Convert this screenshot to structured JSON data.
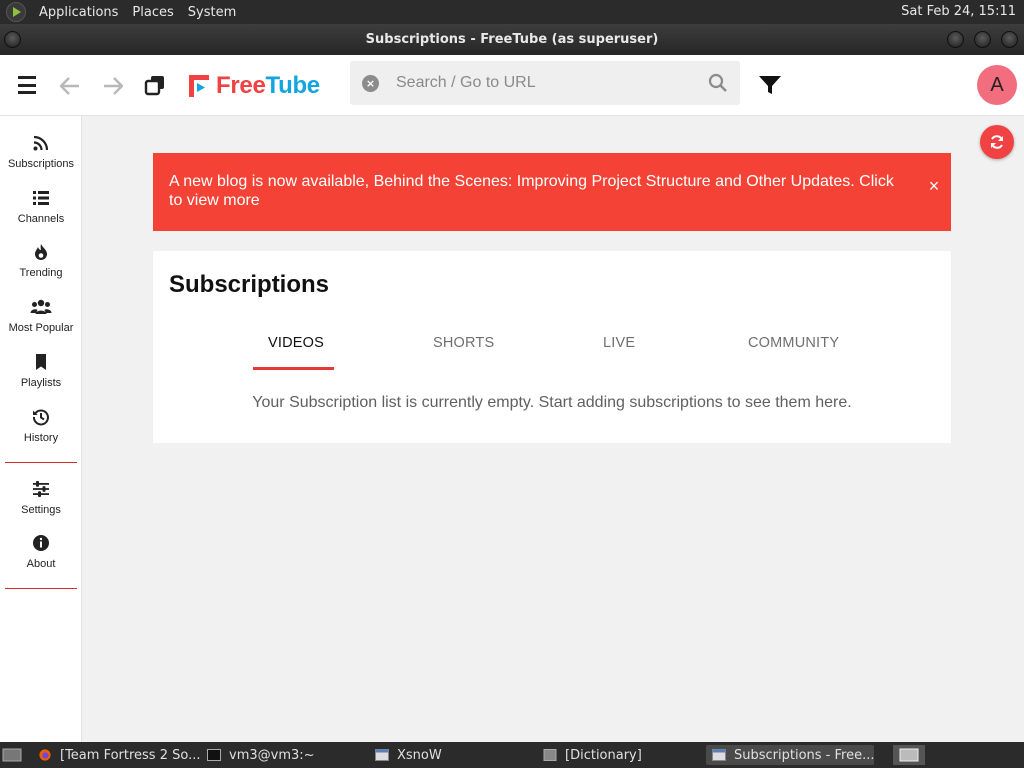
{
  "system_panel": {
    "menus": [
      "Applications",
      "Places",
      "System"
    ],
    "clock": "Sat Feb 24, 15:11"
  },
  "window": {
    "title": "Subscriptions - FreeTube (as superuser)"
  },
  "topnav": {
    "logo_free": "Free",
    "logo_tube": "Tube",
    "search_placeholder": "Search / Go to URL",
    "avatar_letter": "A"
  },
  "sidebar": {
    "items": [
      {
        "label": "Subscriptions",
        "icon": "rss-icon"
      },
      {
        "label": "Channels",
        "icon": "list-icon"
      },
      {
        "label": "Trending",
        "icon": "fire-icon"
      },
      {
        "label": "Most Popular",
        "icon": "users-icon"
      },
      {
        "label": "Playlists",
        "icon": "bookmark-icon"
      },
      {
        "label": "History",
        "icon": "history-icon"
      },
      {
        "label": "Settings",
        "icon": "sliders-icon"
      },
      {
        "label": "About",
        "icon": "info-icon"
      }
    ]
  },
  "banner": {
    "text": "A new blog is now available, Behind the Scenes: Improving Project Structure and Other Updates. Click to view more",
    "close": "×"
  },
  "main": {
    "title": "Subscriptions",
    "tabs": [
      {
        "label": "VIDEOS",
        "active": true
      },
      {
        "label": "SHORTS",
        "active": false
      },
      {
        "label": "LIVE",
        "active": false
      },
      {
        "label": "COMMUNITY",
        "active": false
      }
    ],
    "empty_message": "Your Subscription list is currently empty. Start adding subscriptions to see them here."
  },
  "taskbar": {
    "items": [
      {
        "label": "[Team Fortress 2 So..."
      },
      {
        "label": "vm3@vm3:~"
      },
      {
        "label": "XsnoW"
      },
      {
        "label": "[Dictionary]"
      },
      {
        "label": "Subscriptions - Free..."
      }
    ]
  },
  "colors": {
    "accent": "#f04242",
    "banner": "#f44336",
    "logo_blue": "#14a4df",
    "avatar": "#f26d7d"
  }
}
